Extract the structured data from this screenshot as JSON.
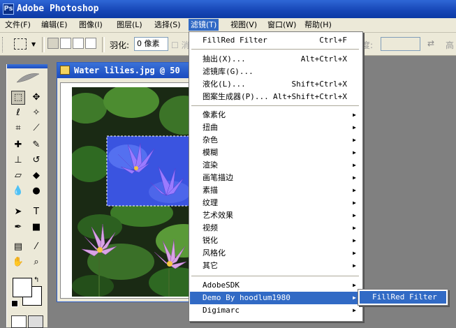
{
  "app": {
    "title": "Adobe Photoshop",
    "icon_letter": "Ps"
  },
  "menubar": [
    {
      "label": "文件(F)",
      "active": false
    },
    {
      "label": "编辑(E)",
      "active": false
    },
    {
      "label": "图像(I)",
      "active": false
    },
    {
      "label": "图层(L)",
      "active": false
    },
    {
      "label": "选择(S)",
      "active": false
    },
    {
      "label": "滤镜(T)",
      "active": true
    },
    {
      "label": "视图(V)",
      "active": false
    },
    {
      "label": "窗口(W)",
      "active": false
    },
    {
      "label": "帮助(H)",
      "active": false
    }
  ],
  "options": {
    "feather_label": "羽化:",
    "feather_value": "0 像素",
    "antialias_label": "消",
    "height_label": "度:",
    "high_label": "高"
  },
  "document": {
    "title": "Water lilies.jpg @ 50"
  },
  "filter_menu": {
    "top": [
      {
        "label": "FillRed Filter",
        "shortcut": "Ctrl+F"
      }
    ],
    "group1": [
      {
        "label": "抽出(X)...",
        "shortcut": "Alt+Ctrl+X"
      },
      {
        "label": "滤镜库(G)...",
        "shortcut": ""
      },
      {
        "label": "液化(L)...",
        "shortcut": "Shift+Ctrl+X"
      },
      {
        "label": "图案生成器(P)...",
        "shortcut": "Alt+Shift+Ctrl+X"
      }
    ],
    "group2": [
      {
        "label": "像素化"
      },
      {
        "label": "扭曲"
      },
      {
        "label": "杂色"
      },
      {
        "label": "模糊"
      },
      {
        "label": "渲染"
      },
      {
        "label": "画笔描边"
      },
      {
        "label": "素描"
      },
      {
        "label": "纹理"
      },
      {
        "label": "艺术效果"
      },
      {
        "label": "视频"
      },
      {
        "label": "锐化"
      },
      {
        "label": "风格化"
      },
      {
        "label": "其它"
      }
    ],
    "group3": [
      {
        "label": "AdobeSDK",
        "highlighted": false
      },
      {
        "label": "Demo By hoodlum1980",
        "highlighted": true
      },
      {
        "label": "Digimarc",
        "highlighted": false
      }
    ]
  },
  "submenu": {
    "items": [
      {
        "label": "FillRed Filter"
      }
    ]
  },
  "colors": {
    "titlebar": "#1848b8",
    "highlight": "#316ac5",
    "menu_bg": "#ece9d8"
  }
}
